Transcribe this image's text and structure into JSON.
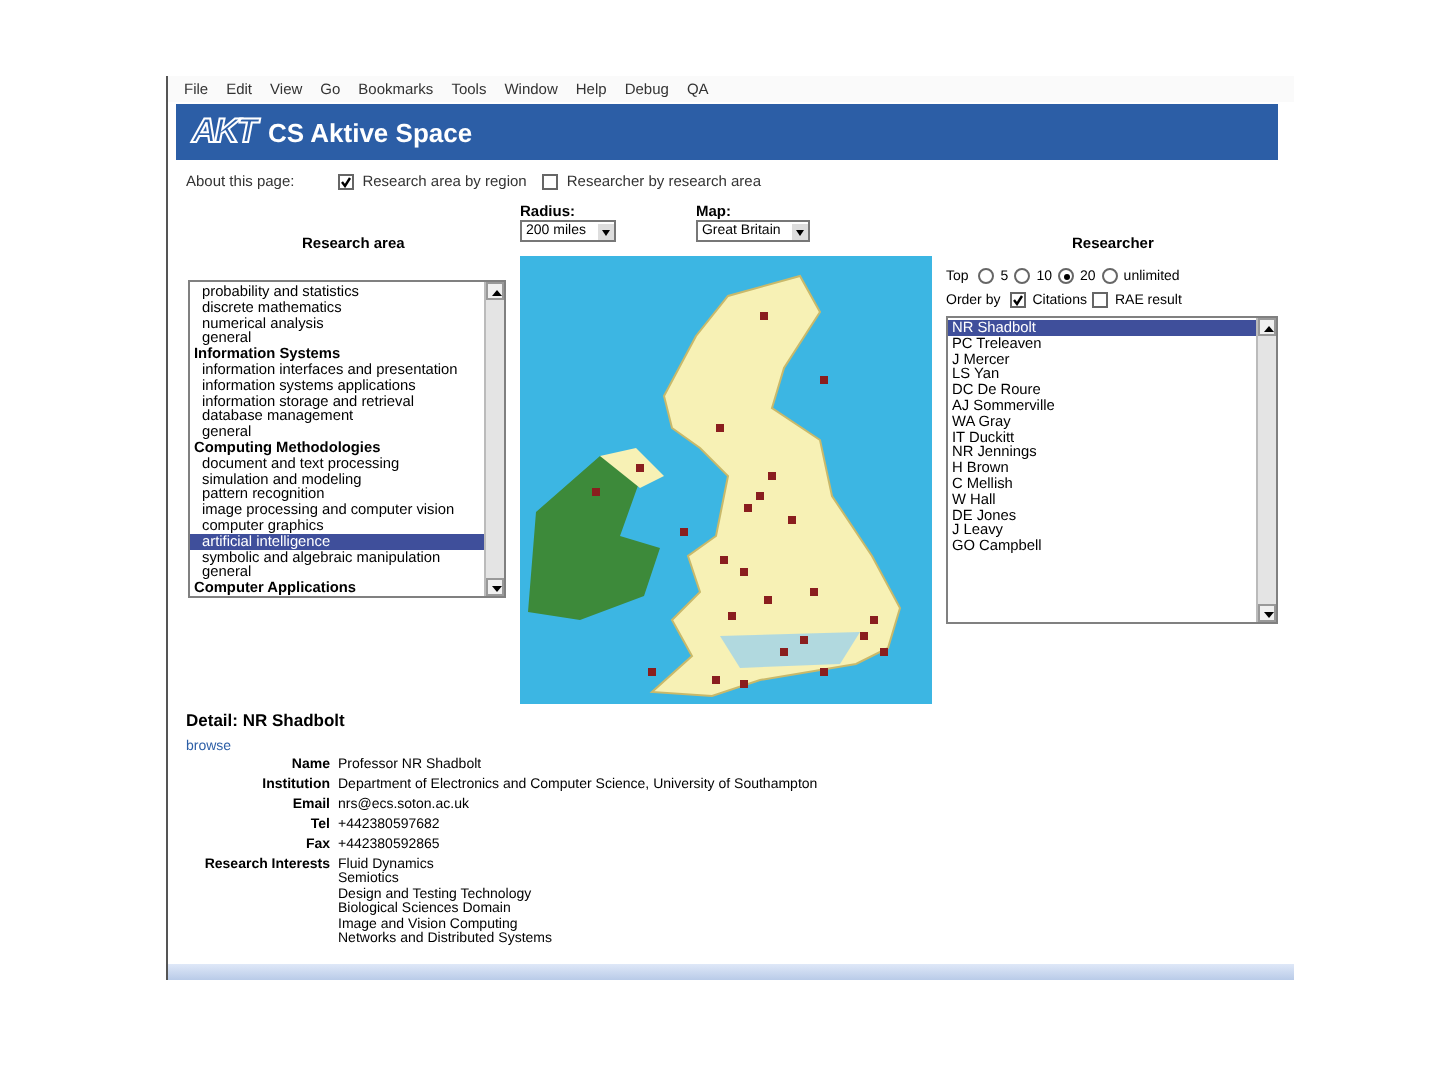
{
  "menu": [
    "File",
    "Edit",
    "View",
    "Go",
    "Bookmarks",
    "Tools",
    "Window",
    "Help",
    "Debug",
    "QA"
  ],
  "header": {
    "logo": "AKT",
    "title": "CS Aktive Space"
  },
  "about": {
    "label": "About this page:",
    "options": [
      {
        "label": "Research area by region",
        "checked": true
      },
      {
        "label": "Researcher by research area",
        "checked": false
      }
    ]
  },
  "research_area": {
    "heading": "Research area",
    "items": [
      {
        "label": "probability and statistics",
        "kind": "topic",
        "selected": false
      },
      {
        "label": "discrete mathematics",
        "kind": "topic",
        "selected": false
      },
      {
        "label": "numerical analysis",
        "kind": "topic",
        "selected": false
      },
      {
        "label": "general",
        "kind": "topic",
        "selected": false
      },
      {
        "label": "Information Systems",
        "kind": "category",
        "selected": false
      },
      {
        "label": "information interfaces and presentation",
        "kind": "topic",
        "selected": false
      },
      {
        "label": "information systems applications",
        "kind": "topic",
        "selected": false
      },
      {
        "label": "information storage and retrieval",
        "kind": "topic",
        "selected": false
      },
      {
        "label": "database management",
        "kind": "topic",
        "selected": false
      },
      {
        "label": "general",
        "kind": "topic",
        "selected": false
      },
      {
        "label": "Computing Methodologies",
        "kind": "category",
        "selected": false
      },
      {
        "label": "document and text processing",
        "kind": "topic",
        "selected": false
      },
      {
        "label": "simulation and modeling",
        "kind": "topic",
        "selected": false
      },
      {
        "label": "pattern recognition",
        "kind": "topic",
        "selected": false
      },
      {
        "label": "image processing and computer vision",
        "kind": "topic",
        "selected": false
      },
      {
        "label": "computer graphics",
        "kind": "topic",
        "selected": false
      },
      {
        "label": "artificial intelligence",
        "kind": "topic",
        "selected": true
      },
      {
        "label": "symbolic and algebraic manipulation",
        "kind": "topic",
        "selected": false
      },
      {
        "label": "general",
        "kind": "topic",
        "selected": false
      },
      {
        "label": "Computer Applications",
        "kind": "category",
        "selected": false
      }
    ]
  },
  "radius": {
    "label": "Radius:",
    "value": "200 miles"
  },
  "map_select": {
    "label": "Map:",
    "value": "Great Britain"
  },
  "researcher": {
    "heading": "Researcher",
    "top_label": "Top",
    "top_options": [
      {
        "label": "5",
        "selected": false
      },
      {
        "label": "10",
        "selected": false
      },
      {
        "label": "20",
        "selected": true
      },
      {
        "label": "unlimited",
        "selected": false
      }
    ],
    "order_label": "Order by",
    "order_options": [
      {
        "label": "Citations",
        "checked": true
      },
      {
        "label": "RAE result",
        "checked": false
      }
    ],
    "items": [
      {
        "name": "NR Shadbolt",
        "selected": true
      },
      {
        "name": "PC Treleaven",
        "selected": false
      },
      {
        "name": "J Mercer",
        "selected": false
      },
      {
        "name": "LS Yan",
        "selected": false
      },
      {
        "name": "DC De Roure",
        "selected": false
      },
      {
        "name": "AJ Sommerville",
        "selected": false
      },
      {
        "name": "WA Gray",
        "selected": false
      },
      {
        "name": "IT Duckitt",
        "selected": false
      },
      {
        "name": "NR Jennings",
        "selected": false
      },
      {
        "name": "H Brown",
        "selected": false
      },
      {
        "name": "C Mellish",
        "selected": false
      },
      {
        "name": "W Hall",
        "selected": false
      },
      {
        "name": "DE Jones",
        "selected": false
      },
      {
        "name": "J Leavy",
        "selected": false
      },
      {
        "name": "GO Campbell",
        "selected": false
      }
    ]
  },
  "detail": {
    "title": "Detail: NR Shadbolt",
    "link": "browse",
    "fields": [
      {
        "label": "Name",
        "value": "Professor NR Shadbolt"
      },
      {
        "label": "Institution",
        "value": "Department of Electronics and Computer Science, University of Southampton"
      },
      {
        "label": "Email",
        "value": "nrs@ecs.soton.ac.uk"
      },
      {
        "label": "Tel",
        "value": "+442380597682"
      },
      {
        "label": "Fax",
        "value": "+442380592865"
      }
    ],
    "interests_label": "Research Interests",
    "interests": [
      "Fluid Dynamics",
      "Semiotics",
      "Design and Testing Technology",
      "Biological Sciences Domain",
      "Image and Vision Computing",
      "Networks and Distributed Systems"
    ]
  }
}
